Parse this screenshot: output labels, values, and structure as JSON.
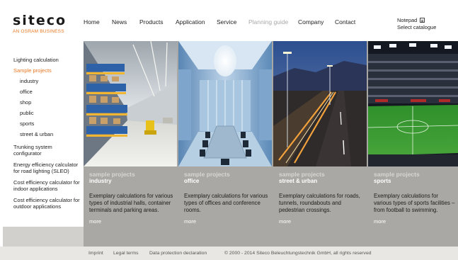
{
  "brand": {
    "name": "siteco",
    "tagline": "AN OSRAM BUSINESS"
  },
  "nav": [
    {
      "label": "Home",
      "state": "normal"
    },
    {
      "label": "News",
      "state": "normal"
    },
    {
      "label": "Products",
      "state": "normal"
    },
    {
      "label": "Application",
      "state": "normal"
    },
    {
      "label": "Service",
      "state": "normal"
    },
    {
      "label": "Planning guide",
      "state": "dimmed"
    },
    {
      "label": "Company",
      "state": "normal"
    },
    {
      "label": "Contact",
      "state": "normal"
    }
  ],
  "tools": {
    "notepad": "Notepad",
    "notepad_icon": "notepad-icon",
    "catalogue": "Select catalogue"
  },
  "sidebar": {
    "items": [
      {
        "label": "Lighting calculation"
      },
      {
        "label": "Sample projects",
        "active": true
      },
      {
        "label": "industry"
      },
      {
        "label": "office"
      },
      {
        "label": "shop"
      },
      {
        "label": "public"
      },
      {
        "label": "sports"
      },
      {
        "label": "street & urban"
      },
      {
        "label": "Trunking system configurator"
      },
      {
        "label": "Energy efficiency calculator for road lighting (SLEO)"
      },
      {
        "label": "Cost efficiency calculator for indoor applications"
      },
      {
        "label": "Cost efficiency calculator for outdoor applications"
      }
    ]
  },
  "columns": [
    {
      "eyebrow": "sample projects",
      "title": "industry",
      "description": "Exemplary calculations for various types of industrial halls, container terminals and parking areas.",
      "more": "more"
    },
    {
      "eyebrow": "sample projects",
      "title": "office",
      "description": "Exemplary calculations for various types of offices and conference rooms.",
      "more": "more"
    },
    {
      "eyebrow": "sample projects",
      "title": "street & urban",
      "description": "Exemplary calculations for roads, tunnels, roundabouts and pedestrian crossings.",
      "more": "more"
    },
    {
      "eyebrow": "sample projects",
      "title": "sports",
      "description": "Exemplary calculations for various types of sports facilities – from football to swimming.",
      "more": "more"
    }
  ],
  "footer": {
    "imprint": "Imprint",
    "legal": "Legal terms",
    "privacy": "Data protection declaration",
    "copyright": "© 2000 - 2014 Siteco Beleuchtungstechnik GmbH, all rights reserved"
  },
  "colors": {
    "accent": "#e87722",
    "panel": "#aaa8a4",
    "footer": "#e9e7e3"
  }
}
